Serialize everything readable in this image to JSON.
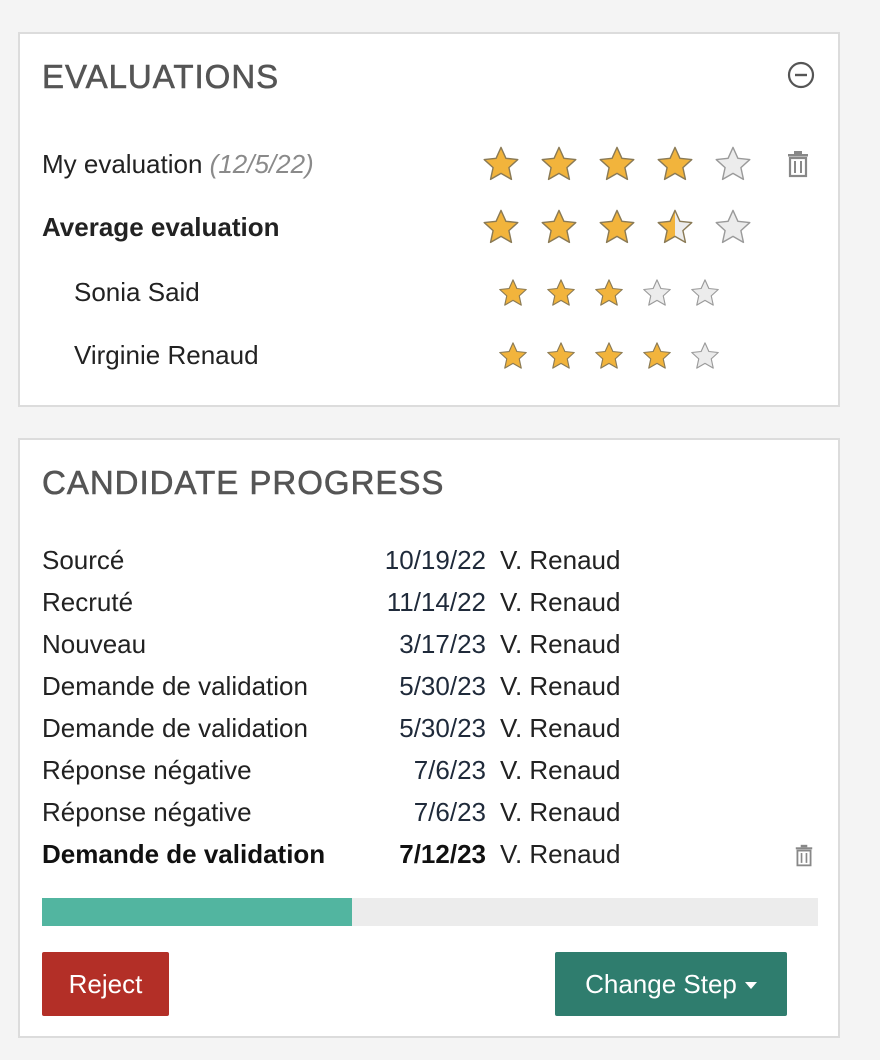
{
  "evaluations": {
    "title": "EVALUATIONS",
    "collapse_icon": "minus-circle-icon",
    "rows": [
      {
        "label": "My evaluation",
        "date": "(12/5/22)",
        "rating": 4,
        "max": 5,
        "bold": false,
        "deletable": true
      },
      {
        "label": "Average evaluation",
        "rating": 3.5,
        "max": 5,
        "bold": true
      },
      {
        "label": "Sonia Said",
        "rating": 3,
        "max": 5
      },
      {
        "label": "Virginie Renaud",
        "rating": 4,
        "max": 5
      }
    ]
  },
  "progress": {
    "title": "CANDIDATE PROGRESS",
    "steps": [
      {
        "name": "Sourcé",
        "date": "10/19/22",
        "user": "V. Renaud"
      },
      {
        "name": "Recruté",
        "date": "11/14/22",
        "user": "V. Renaud"
      },
      {
        "name": "Nouveau",
        "date": "3/17/23",
        "user": "V. Renaud"
      },
      {
        "name": "Demande de validation",
        "date": "5/30/23",
        "user": "V. Renaud"
      },
      {
        "name": "Demande de validation",
        "date": "5/30/23",
        "user": "V. Renaud"
      },
      {
        "name": "Réponse négative",
        "date": "7/6/23",
        "user": "V. Renaud"
      },
      {
        "name": "Réponse négative",
        "date": "7/6/23",
        "user": "V. Renaud"
      },
      {
        "name": "Demande de validation",
        "date": "7/12/23",
        "user": "V. Renaud",
        "current": true
      }
    ],
    "progress_fraction": 0.4
  },
  "buttons": {
    "reject_label": "Reject",
    "change_step_label": "Change Step"
  },
  "colors": {
    "star_filled": "#f2b43c",
    "star_empty": "#ececec",
    "progress_fill": "#52b5a0",
    "reject": "#b32f27",
    "change_step": "#2f7d6e"
  }
}
